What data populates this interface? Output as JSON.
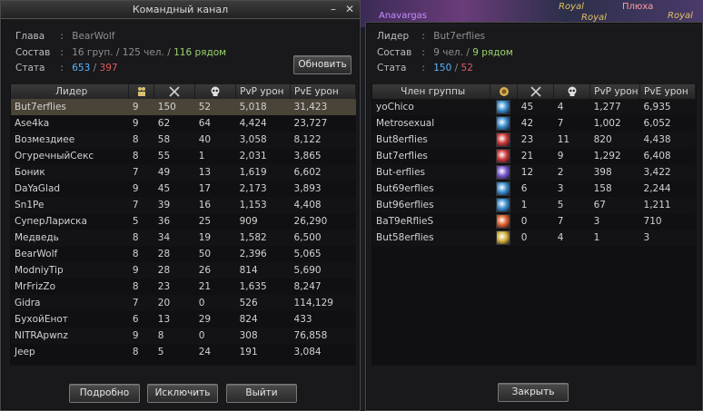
{
  "left_window": {
    "title": "Командный канал",
    "info": {
      "leader_label": "Глава",
      "leader_value": "BearWolf",
      "composition_label": "Состав",
      "groups": "16 груп.",
      "people": "125 чел.",
      "nearby": "116 рядом",
      "stats_label": "Стата",
      "kills": "653",
      "deaths": "397",
      "sep": ":",
      "slash": "/"
    },
    "refresh_button": "Обновить",
    "columns": [
      "Лидер",
      "",
      "",
      "",
      "PvP урон",
      "PvE урон"
    ],
    "column_icons": [
      "group-icon",
      "swords-icon",
      "skull-icon"
    ],
    "rows": [
      [
        "But7erflies",
        "9",
        "150",
        "52",
        "5,018",
        "31,423"
      ],
      [
        "Ase4ka",
        "9",
        "62",
        "64",
        "4,424",
        "23,727"
      ],
      [
        "Возмездиее",
        "8",
        "58",
        "40",
        "3,058",
        "8,122"
      ],
      [
        "ОгуречныйСекс",
        "8",
        "55",
        "1",
        "2,031",
        "3,865"
      ],
      [
        "Боник",
        "7",
        "49",
        "13",
        "1,619",
        "6,602"
      ],
      [
        "DaYaGlad",
        "9",
        "45",
        "17",
        "2,173",
        "3,893"
      ],
      [
        "Sn1Pe",
        "7",
        "39",
        "16",
        "1,153",
        "4,408"
      ],
      [
        "СуперЛариска",
        "5",
        "36",
        "25",
        "909",
        "26,290"
      ],
      [
        "Медведь",
        "8",
        "34",
        "19",
        "1,582",
        "6,500"
      ],
      [
        "BearWolf",
        "8",
        "28",
        "50",
        "2,396",
        "5,065"
      ],
      [
        "ModniyTip",
        "9",
        "28",
        "26",
        "814",
        "5,690"
      ],
      [
        "MrFrizZo",
        "8",
        "23",
        "21",
        "1,635",
        "8,247"
      ],
      [
        "Gidra",
        "7",
        "20",
        "0",
        "526",
        "114,129"
      ],
      [
        "БухойЕнот",
        "6",
        "13",
        "29",
        "824",
        "433"
      ],
      [
        "NITRApwnz",
        "9",
        "8",
        "0",
        "308",
        "76,858"
      ],
      [
        "Jeep",
        "8",
        "5",
        "24",
        "191",
        "3,084"
      ]
    ],
    "buttons": {
      "details": "Подробно",
      "exclude": "Исключить",
      "leave": "Выйти"
    }
  },
  "right_window": {
    "info": {
      "leader_label": "Лидер",
      "leader_value": "But7erflies",
      "composition_label": "Состав",
      "people": "9 чел.",
      "nearby": "9 рядом",
      "stats_label": "Стата",
      "kills": "150",
      "deaths": "52",
      "sep": ":",
      "slash": "/"
    },
    "columns": [
      "Член группы",
      "",
      "",
      "",
      "PvP урон",
      "PvE урон"
    ],
    "column_icons": [
      "class-icon",
      "swords-icon",
      "skull-icon"
    ],
    "rows": [
      {
        "name": "yoChico",
        "class_color": "#3a8fd0",
        "k": "45",
        "d": "4",
        "pvp": "1,277",
        "pve": "6,935"
      },
      {
        "name": "Metrosexual",
        "class_color": "#3a8fd0",
        "k": "42",
        "d": "7",
        "pvp": "1,002",
        "pve": "6,052"
      },
      {
        "name": "But8erflies",
        "class_color": "#d03a3a",
        "k": "23",
        "d": "11",
        "pvp": "820",
        "pve": "4,438"
      },
      {
        "name": "But7erflies",
        "class_color": "#d03a3a",
        "k": "21",
        "d": "9",
        "pvp": "1,292",
        "pve": "6,408"
      },
      {
        "name": "But-erflies",
        "class_color": "#7a5ad0",
        "k": "12",
        "d": "2",
        "pvp": "398",
        "pve": "3,422"
      },
      {
        "name": "But69erflies",
        "class_color": "#3a8fd0",
        "k": "6",
        "d": "3",
        "pvp": "158",
        "pve": "2,244"
      },
      {
        "name": "But96erflies",
        "class_color": "#3a8fd0",
        "k": "1",
        "d": "5",
        "pvp": "67",
        "pve": "1,211"
      },
      {
        "name": "BaT9eRflieS",
        "class_color": "#e0602a",
        "k": "0",
        "d": "7",
        "pvp": "3",
        "pve": "710"
      },
      {
        "name": "But58erflies",
        "class_color": "#d0b03a",
        "k": "0",
        "d": "4",
        "pvp": "1",
        "pve": "3"
      }
    ],
    "close_button": "Закрыть"
  },
  "background": {
    "names": [
      "Anavargas",
      "Royal",
      "Royal",
      "Royal",
      "Плюха",
      "Royal"
    ]
  }
}
